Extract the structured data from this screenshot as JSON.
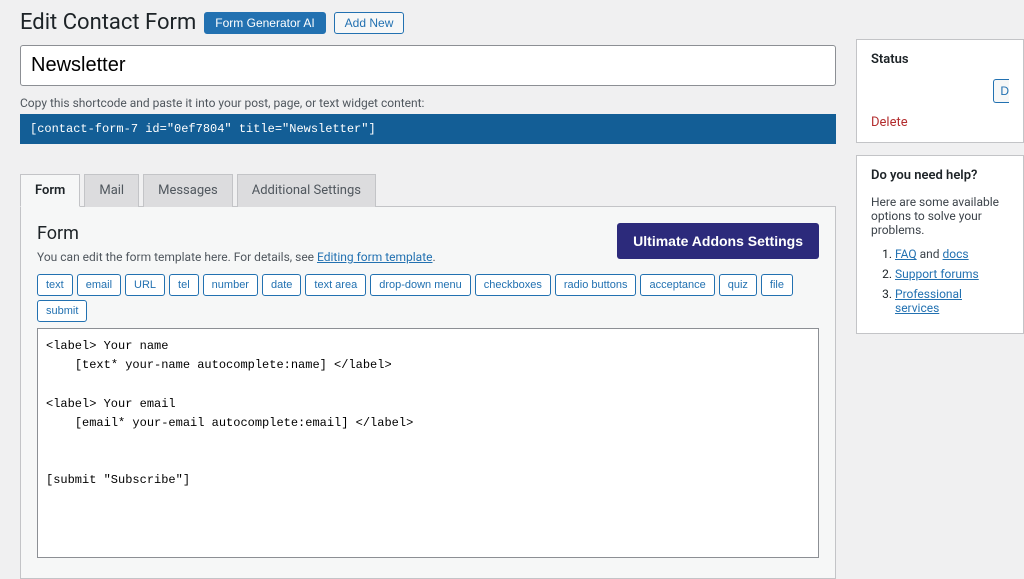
{
  "header": {
    "title": "Edit Contact Form",
    "gen_ai_label": "Form Generator AI",
    "add_new_label": "Add New"
  },
  "form_title_value": "Newsletter",
  "shortcode_label": "Copy this shortcode and paste it into your post, page, or text widget content:",
  "shortcode_value": "[contact-form-7 id=\"0ef7804\" title=\"Newsletter\"]",
  "tabs": {
    "form": "Form",
    "mail": "Mail",
    "messages": "Messages",
    "additional": "Additional Settings"
  },
  "panel": {
    "heading": "Form",
    "ultimate_label": "Ultimate Addons Settings",
    "desc_prefix": "You can edit the form template here. For details, see ",
    "desc_link": "Editing form template",
    "desc_suffix": "."
  },
  "tags": [
    "text",
    "email",
    "URL",
    "tel",
    "number",
    "date",
    "text area",
    "drop-down menu",
    "checkboxes",
    "radio buttons",
    "acceptance",
    "quiz",
    "file",
    "submit"
  ],
  "textarea_value": "<label> Your name\n    [text* your-name autocomplete:name] </label>\n\n<label> Your email\n    [email* your-email autocomplete:email] </label>\n\n\n[submit \"Subscribe\"]",
  "status_box": {
    "heading": "Status",
    "duplicate_fragment": "D",
    "delete_label": "Delete"
  },
  "help_box": {
    "heading": "Do you need help?",
    "intro": "Here are some available options to solve your problems.",
    "items": [
      {
        "link1": "FAQ",
        "sep": " and ",
        "link2": "docs"
      },
      {
        "link1": "Support forums",
        "sep": "",
        "link2": ""
      },
      {
        "link1": "Professional services",
        "sep": "",
        "link2": ""
      }
    ]
  }
}
